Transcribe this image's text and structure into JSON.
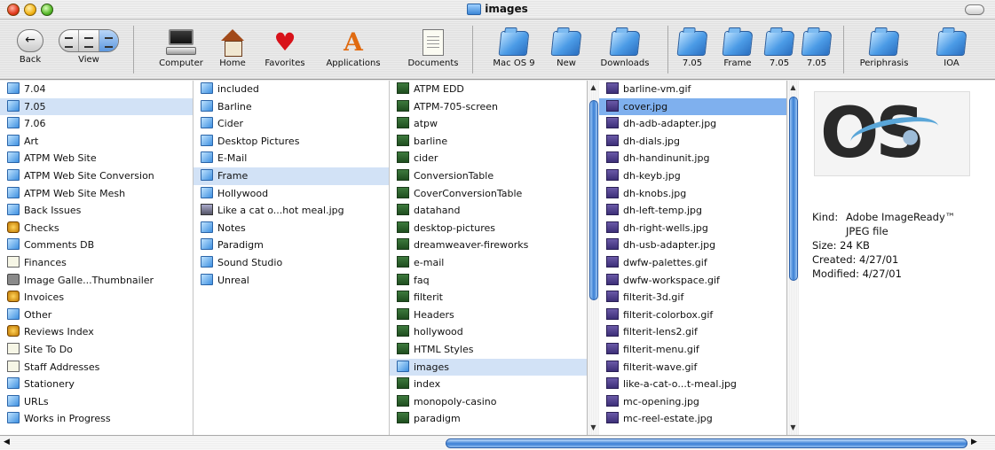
{
  "window": {
    "title": "images"
  },
  "toolbar": {
    "back": "Back",
    "view": "View",
    "items": [
      "Computer",
      "Home",
      "Favorites",
      "Applications",
      "Documents"
    ],
    "folders": [
      "Mac OS 9",
      "New",
      "Downloads",
      "7.05",
      "Frame",
      "7.05",
      "7.05",
      "Periphrasis",
      "IOA"
    ]
  },
  "col1": [
    {
      "label": "7.04",
      "icon": "folder"
    },
    {
      "label": "7.05",
      "icon": "folder",
      "sel": true
    },
    {
      "label": "7.06",
      "icon": "folder"
    },
    {
      "label": "Art",
      "icon": "folder"
    },
    {
      "label": "ATPM Web Site",
      "icon": "folder"
    },
    {
      "label": "ATPM Web Site Conversion",
      "icon": "folder"
    },
    {
      "label": "ATPM Web Site Mesh",
      "icon": "folder"
    },
    {
      "label": "Back Issues",
      "icon": "folder"
    },
    {
      "label": "Checks",
      "icon": "badge"
    },
    {
      "label": "Comments DB",
      "icon": "folder"
    },
    {
      "label": "Finances",
      "icon": "doc"
    },
    {
      "label": "Image Galle...Thumbnailer",
      "icon": "app"
    },
    {
      "label": "Invoices",
      "icon": "badge"
    },
    {
      "label": "Other",
      "icon": "folder"
    },
    {
      "label": "Reviews Index",
      "icon": "badge"
    },
    {
      "label": "Site To Do",
      "icon": "doc"
    },
    {
      "label": "Staff Addresses",
      "icon": "doc"
    },
    {
      "label": "Stationery",
      "icon": "folder"
    },
    {
      "label": "URLs",
      "icon": "folder"
    },
    {
      "label": "Works in Progress",
      "icon": "folder"
    }
  ],
  "col2": [
    {
      "label": "included",
      "icon": "folder"
    },
    {
      "label": "Barline",
      "icon": "folder"
    },
    {
      "label": "Cider",
      "icon": "folder"
    },
    {
      "label": "Desktop Pictures",
      "icon": "folder"
    },
    {
      "label": "E-Mail",
      "icon": "folder"
    },
    {
      "label": "Frame",
      "icon": "folder",
      "sel": true
    },
    {
      "label": "Hollywood",
      "icon": "folder"
    },
    {
      "label": "Like a cat o...hot meal.jpg",
      "icon": "img"
    },
    {
      "label": "Notes",
      "icon": "folder"
    },
    {
      "label": "Paradigm",
      "icon": "folder"
    },
    {
      "label": "Sound Studio",
      "icon": "folder"
    },
    {
      "label": "Unreal",
      "icon": "folder"
    }
  ],
  "col3": [
    {
      "label": "ATPM EDD",
      "icon": "page"
    },
    {
      "label": "ATPM-705-screen",
      "icon": "page"
    },
    {
      "label": "atpw",
      "icon": "page"
    },
    {
      "label": "barline",
      "icon": "page"
    },
    {
      "label": "cider",
      "icon": "page"
    },
    {
      "label": "ConversionTable",
      "icon": "page"
    },
    {
      "label": "CoverConversionTable",
      "icon": "page"
    },
    {
      "label": "datahand",
      "icon": "page"
    },
    {
      "label": "desktop-pictures",
      "icon": "page"
    },
    {
      "label": "dreamweaver-fireworks",
      "icon": "page"
    },
    {
      "label": "e-mail",
      "icon": "page"
    },
    {
      "label": "faq",
      "icon": "page"
    },
    {
      "label": "filterit",
      "icon": "page"
    },
    {
      "label": "Headers",
      "icon": "page"
    },
    {
      "label": "hollywood",
      "icon": "page"
    },
    {
      "label": "HTML Styles",
      "icon": "page"
    },
    {
      "label": "images",
      "icon": "folder",
      "sel": true
    },
    {
      "label": "index",
      "icon": "page"
    },
    {
      "label": "monopoly-casino",
      "icon": "page"
    },
    {
      "label": "paradigm",
      "icon": "page"
    }
  ],
  "col4": [
    {
      "label": "barline-vm.gif",
      "icon": "gif"
    },
    {
      "label": "cover.jpg",
      "icon": "gif",
      "sel": true
    },
    {
      "label": "dh-adb-adapter.jpg",
      "icon": "gif"
    },
    {
      "label": "dh-dials.jpg",
      "icon": "gif"
    },
    {
      "label": "dh-handinunit.jpg",
      "icon": "gif"
    },
    {
      "label": "dh-keyb.jpg",
      "icon": "gif"
    },
    {
      "label": "dh-knobs.jpg",
      "icon": "gif"
    },
    {
      "label": "dh-left-temp.jpg",
      "icon": "gif"
    },
    {
      "label": "dh-right-wells.jpg",
      "icon": "gif"
    },
    {
      "label": "dh-usb-adapter.jpg",
      "icon": "gif"
    },
    {
      "label": "dwfw-palettes.gif",
      "icon": "gif"
    },
    {
      "label": "dwfw-workspace.gif",
      "icon": "gif"
    },
    {
      "label": "filterit-3d.gif",
      "icon": "gif"
    },
    {
      "label": "filterit-colorbox.gif",
      "icon": "gif"
    },
    {
      "label": "filterit-lens2.gif",
      "icon": "gif"
    },
    {
      "label": "filterit-menu.gif",
      "icon": "gif"
    },
    {
      "label": "filterit-wave.gif",
      "icon": "gif"
    },
    {
      "label": "like-a-cat-o...t-meal.jpg",
      "icon": "gif"
    },
    {
      "label": "mc-opening.jpg",
      "icon": "gif"
    },
    {
      "label": "mc-reel-estate.jpg",
      "icon": "gif"
    }
  ],
  "preview": {
    "kind_label": "Kind:",
    "kind_value": "Adobe ImageReady™ JPEG file",
    "size": "Size: 24 KB",
    "created": "Created: 4/27/01",
    "modified": "Modified: 4/27/01"
  }
}
